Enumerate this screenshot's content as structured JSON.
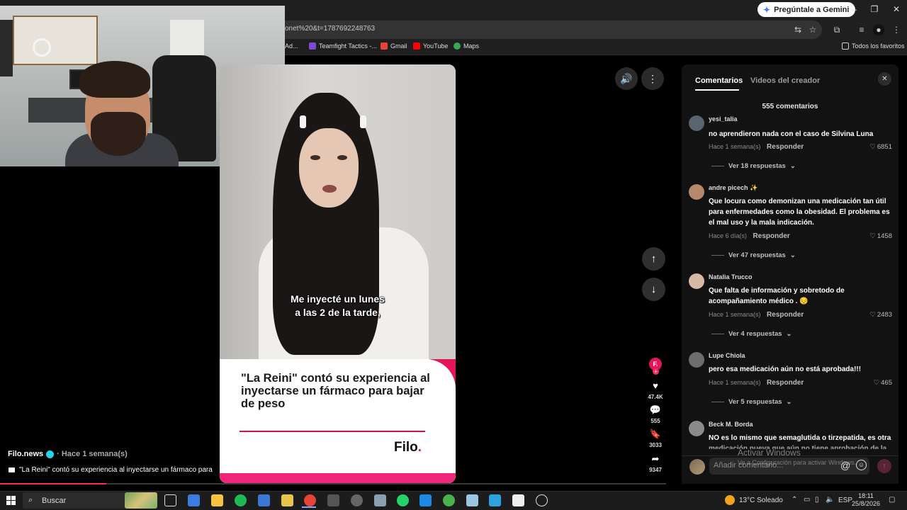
{
  "browser": {
    "gemini_button": "Pregúntale a Gemini",
    "url_fragment": "onet%20&t=1787692248763",
    "bookmarks": [
      {
        "label": "Ad...",
        "color": "#888888"
      },
      {
        "label": "Teamfight Tactics -...",
        "color": "#7b4bd6"
      },
      {
        "label": "Gmail",
        "color": "#ea4335"
      },
      {
        "label": "YouTube",
        "color": "#ff0000"
      },
      {
        "label": "Maps",
        "color": "#34a853"
      }
    ],
    "all_bookmarks": "Todos los favoritos",
    "window_controls": {
      "minimize": "—",
      "restore": "❐",
      "close": "✕"
    }
  },
  "video": {
    "subtitle_line1": "Me inyecté un lunes",
    "subtitle_line2": "a las 2 de la tarde,",
    "card_title": "\"La Reini\" contó su experiencia al inyectarse un fármaco para bajar de peso",
    "logo_text": "Filo",
    "logo_dot": "."
  },
  "actions": {
    "avatar_letter": "F.",
    "likes": "47.4K",
    "comments": "555",
    "saves": "3033",
    "shares": "9347"
  },
  "creator": {
    "name": "Filo.news",
    "time": "· Hace 1 semana(s)",
    "caption": "\"La Reini\" contó su experiencia al inyectarse un fármaco para"
  },
  "progress": 0.16,
  "comments_panel": {
    "tab_comments": "Comentarios",
    "tab_creator_videos": "Videos del creador",
    "count_text": "555 comentarios",
    "reply_label": "Responder",
    "comments": [
      {
        "user": "yesi_talia",
        "text": "no aprendieron nada con el caso de Silvina Luna",
        "time": "Hace 1 semana(s)",
        "likes": "6851",
        "replies": "Ver 18 respuestas",
        "avatar_color": "#5a6470"
      },
      {
        "user": "andre picech ✨",
        "text": "Que locura como demonizan una medicación tan útil para enfermedades como la obesidad. El problema es el mal uso y la mala indicación.",
        "time": "Hace 6 día(s)",
        "likes": "1458",
        "replies": "Ver 47 respuestas",
        "avatar_color": "#b58a6a"
      },
      {
        "user": "Natalia Trucco",
        "text": "Que falta de información y sobretodo de acompañamiento médico . 😔",
        "time": "Hace 1 semana(s)",
        "likes": "2483",
        "replies": "Ver 4 respuestas",
        "avatar_color": "#d9b8a6"
      },
      {
        "user": "Lupe Chiola",
        "text": "pero esa medicación aún no está aprobada!!!",
        "time": "Hace 1 semana(s)",
        "likes": "465",
        "replies": "Ver 5 respuestas",
        "avatar_color": "#6d6d6d"
      },
      {
        "user": "Beck M. Borda",
        "text": "NO es lo mismo que semaglutida o tirzepatida, es otra medicación nueva que aún no tiene aprobación de la",
        "avatar_color": "#8a8a8a"
      }
    ],
    "input_placeholder": "Añadir comentario..."
  },
  "watermark": {
    "line1": "Activar Windows",
    "line2": "Ve a Configuración para activar Windows."
  },
  "taskbar": {
    "search_label": "Buscar",
    "weather": "13°C  Soleado",
    "language": "ESP",
    "time": "18:11",
    "date": "25/8/2026"
  }
}
